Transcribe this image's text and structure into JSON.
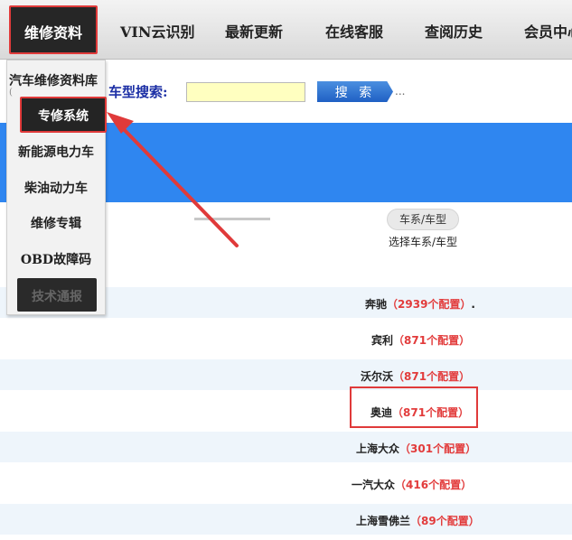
{
  "nav": {
    "active": "维修资料",
    "items": [
      "VIN云识别",
      "最新更新",
      "在线客服",
      "查阅历史",
      "会员中心"
    ]
  },
  "search": {
    "label": "车型搜索:",
    "value": "",
    "button": "搜 索",
    "ellipsis": "..."
  },
  "filter": {
    "series_pill": "车系/车型",
    "series_caption": "选择车系/车型"
  },
  "brands": [
    {
      "name": "奔驰",
      "count": "（2939个配置）",
      "suffix": "."
    },
    {
      "name": "宾利",
      "count": "（871个配置）",
      "suffix": ""
    },
    {
      "name": "沃尔沃",
      "count": "（871个配置）",
      "suffix": ""
    },
    {
      "name": "奥迪",
      "count": "（871个配置）",
      "suffix": ""
    },
    {
      "name": "上海大众",
      "count": "（301个配置）",
      "suffix": ""
    },
    {
      "name": "一汽大众",
      "count": "（416个配置）",
      "suffix": ""
    },
    {
      "name": "上海雪佛兰",
      "count": "（89个配置）",
      "suffix": ""
    }
  ],
  "dropdown": {
    "heading": "汽车维修资料库",
    "highlighted": "专修系统",
    "items": [
      "新能源电力车",
      "柴油动力车",
      "维修专辑",
      "OBD故障码"
    ],
    "bottom": "技术通报"
  },
  "colors": {
    "accent_red": "#e03a3a",
    "banner_blue": "#2f86f0",
    "label_blue": "#1c2fa5",
    "count_red": "#e23b3b"
  }
}
